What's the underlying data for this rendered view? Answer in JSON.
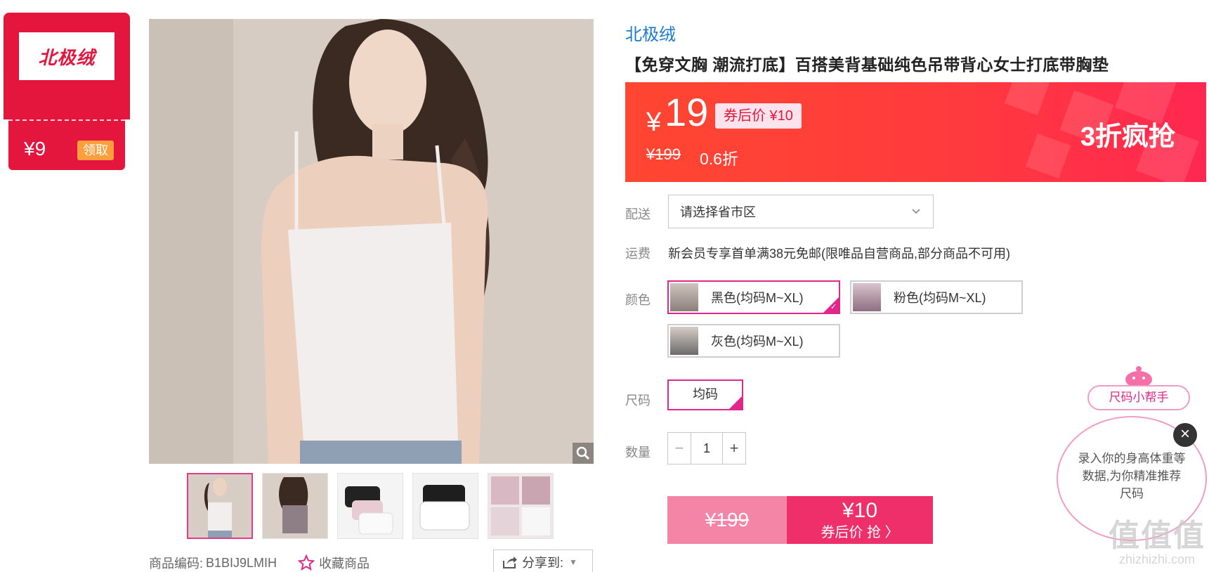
{
  "coupon": {
    "brand_logo": "北极绒",
    "price": "¥9",
    "claim_label": "领取"
  },
  "gallery": {
    "zoom_icon": "magnifier-icon",
    "thumbnails": [
      "白色正面",
      "灰色背面",
      "多色平铺",
      "黑白平铺",
      "细节图"
    ]
  },
  "product_meta": {
    "code_label": "商品编码:",
    "code_value": "B1BIJ9LMIH",
    "favorite_label": "收藏商品",
    "share_label": "分享到:"
  },
  "product": {
    "brand": "北极绒",
    "title": "【免穿文胸 潮流打底】百搭美背基础纯色吊带背心女士打底带胸垫"
  },
  "price_banner": {
    "currency": "¥",
    "price": "19",
    "coupon_price": "券后价 ¥10",
    "original_price": "¥199",
    "discount": "0.6折",
    "promo_text": "3折疯抢"
  },
  "delivery": {
    "label": "配送",
    "placeholder": "请选择省市区"
  },
  "shipping": {
    "label": "运费",
    "text": "新会员专享首单满38元免邮(限唯品自营商品,部分商品不可用)"
  },
  "colors": {
    "label": "颜色",
    "options": [
      "黑色(均码M~XL)",
      "粉色(均码M~XL)",
      "灰色(均码M~XL)"
    ],
    "selected": "黑色(均码M~XL)"
  },
  "size": {
    "label": "尺码",
    "option": "均码"
  },
  "quantity": {
    "label": "数量",
    "value": "1",
    "minus": "−",
    "plus": "+"
  },
  "buy": {
    "original_price": "¥199",
    "coupon_price": "¥10",
    "action_label": "券后价 抢 〉"
  },
  "size_helper": {
    "tag": "尺码小帮手",
    "bubble_text": "录入你的身高体重等数据,为你精准推荐尺码",
    "close": "×"
  },
  "watermark": {
    "big": "值值值",
    "small": "zhizhizhi.com"
  },
  "colors_theme": {
    "accent_red": "#e5163e",
    "pink": "#e0288b",
    "link_blue": "#1a7ad0",
    "banner_orange": "#ff4631"
  }
}
